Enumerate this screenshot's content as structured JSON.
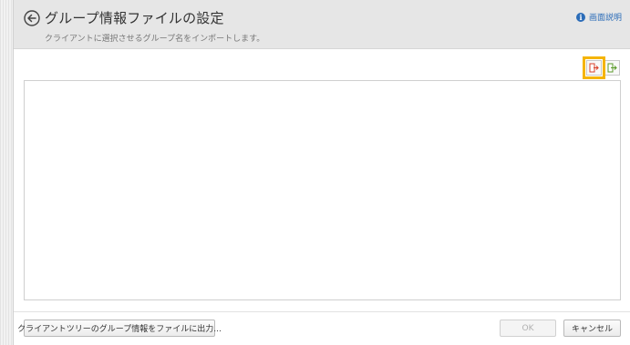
{
  "header": {
    "title": "グループ情報ファイルの設定",
    "subtitle": "クライアントに選択させるグループ名をインポートします。",
    "help_label": "画面説明"
  },
  "toolbar": {
    "import_icon": "file-import-icon",
    "export_icon": "file-export-icon"
  },
  "footer": {
    "export_tree_label": "クライアントツリーのグループ情報をファイルに出力...",
    "ok_label": "OK",
    "cancel_label": "キャンセル"
  },
  "colors": {
    "highlight": "#f5b400",
    "link": "#2b6cb8",
    "header_bg": "#e6e6e6",
    "import_icon": "#d9412b",
    "export_icon": "#5a9a2a"
  }
}
